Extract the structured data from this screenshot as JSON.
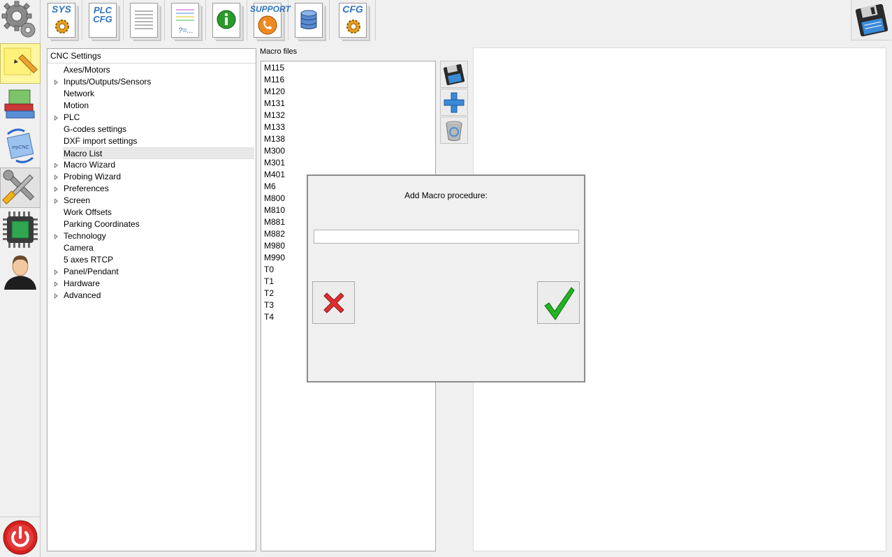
{
  "toolbar": {
    "buttons": [
      {
        "name": "sys",
        "label": "SYS"
      },
      {
        "name": "plc-cfg",
        "label": "PLC CFG"
      },
      {
        "name": "documents",
        "label": ""
      },
      {
        "name": "variables",
        "label": "?=..."
      },
      {
        "name": "info",
        "label": ""
      },
      {
        "name": "support",
        "label": "SUPPORT"
      },
      {
        "name": "database",
        "label": ""
      },
      {
        "name": "cfg",
        "label": "CFG"
      }
    ]
  },
  "tree": {
    "header": "CNC Settings",
    "items": [
      {
        "label": "Axes/Motors",
        "expandable": false
      },
      {
        "label": "Inputs/Outputs/Sensors",
        "expandable": true
      },
      {
        "label": "Network",
        "expandable": false
      },
      {
        "label": "Motion",
        "expandable": false
      },
      {
        "label": "PLC",
        "expandable": true
      },
      {
        "label": "G-codes settings",
        "expandable": false
      },
      {
        "label": "DXF import settings",
        "expandable": false
      },
      {
        "label": "Macro List",
        "expandable": false,
        "selected": true
      },
      {
        "label": "Macro Wizard",
        "expandable": true
      },
      {
        "label": "Probing Wizard",
        "expandable": true
      },
      {
        "label": "Preferences",
        "expandable": true
      },
      {
        "label": "Screen",
        "expandable": true
      },
      {
        "label": "Work Offsets",
        "expandable": false
      },
      {
        "label": "Parking Coordinates",
        "expandable": false
      },
      {
        "label": "Technology",
        "expandable": true
      },
      {
        "label": "Camera",
        "expandable": false
      },
      {
        "label": "5 axes RTCP",
        "expandable": false
      },
      {
        "label": "Panel/Pendant",
        "expandable": true
      },
      {
        "label": "Hardware",
        "expandable": true
      },
      {
        "label": "Advanced",
        "expandable": true
      }
    ]
  },
  "macros": {
    "label": "Macro files",
    "items": [
      "M115",
      "M116",
      "M120",
      "M131",
      "M132",
      "M133",
      "M138",
      "M300",
      "M301",
      "M401",
      "M6",
      "M800",
      "M810",
      "M881",
      "M882",
      "M980",
      "M990",
      "T0",
      "T1",
      "T2",
      "T3",
      "T4"
    ]
  },
  "dialog": {
    "title": "Add Macro procedure:",
    "input_value": ""
  },
  "colors": {
    "accent": "#2f74c0",
    "cancel": "#e03030",
    "ok": "#22b422",
    "power": "#d62020"
  }
}
